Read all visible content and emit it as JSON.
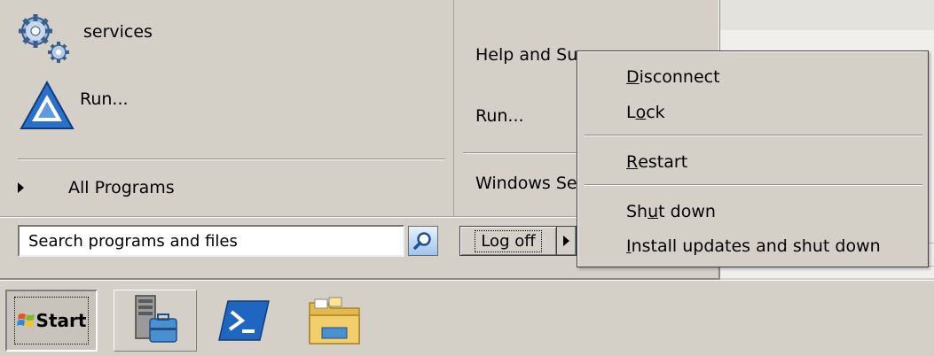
{
  "start_menu": {
    "left_items": [
      {
        "label": "services",
        "icon": "services-gear-icon"
      },
      {
        "label": "Run...",
        "icon": "run-icon"
      }
    ],
    "all_programs": "All Programs",
    "right_items": [
      {
        "label": "Help and Su"
      },
      {
        "label": "Run..."
      },
      {
        "label": "Windows Se"
      }
    ],
    "search": {
      "placeholder": "Search programs and files"
    },
    "logoff_label": "Log off"
  },
  "submenu": {
    "items": [
      {
        "pre": "",
        "key": "D",
        "post": "isconnect"
      },
      {
        "pre": "L",
        "key": "o",
        "post": "ck"
      },
      {
        "pre": "",
        "key": "R",
        "post": "estart"
      },
      {
        "pre": "Sh",
        "key": "u",
        "post": "t down"
      },
      {
        "pre": "",
        "key": "I",
        "post": "nstall updates and shut down"
      }
    ]
  },
  "taskbar": {
    "start_label": "Start",
    "buttons": [
      {
        "icon": "server-manager-icon"
      },
      {
        "icon": "powershell-icon"
      },
      {
        "icon": "file-explorer-icon"
      }
    ]
  },
  "colors": {
    "face": "#d4d0c8",
    "accent": "#1f66c1"
  }
}
